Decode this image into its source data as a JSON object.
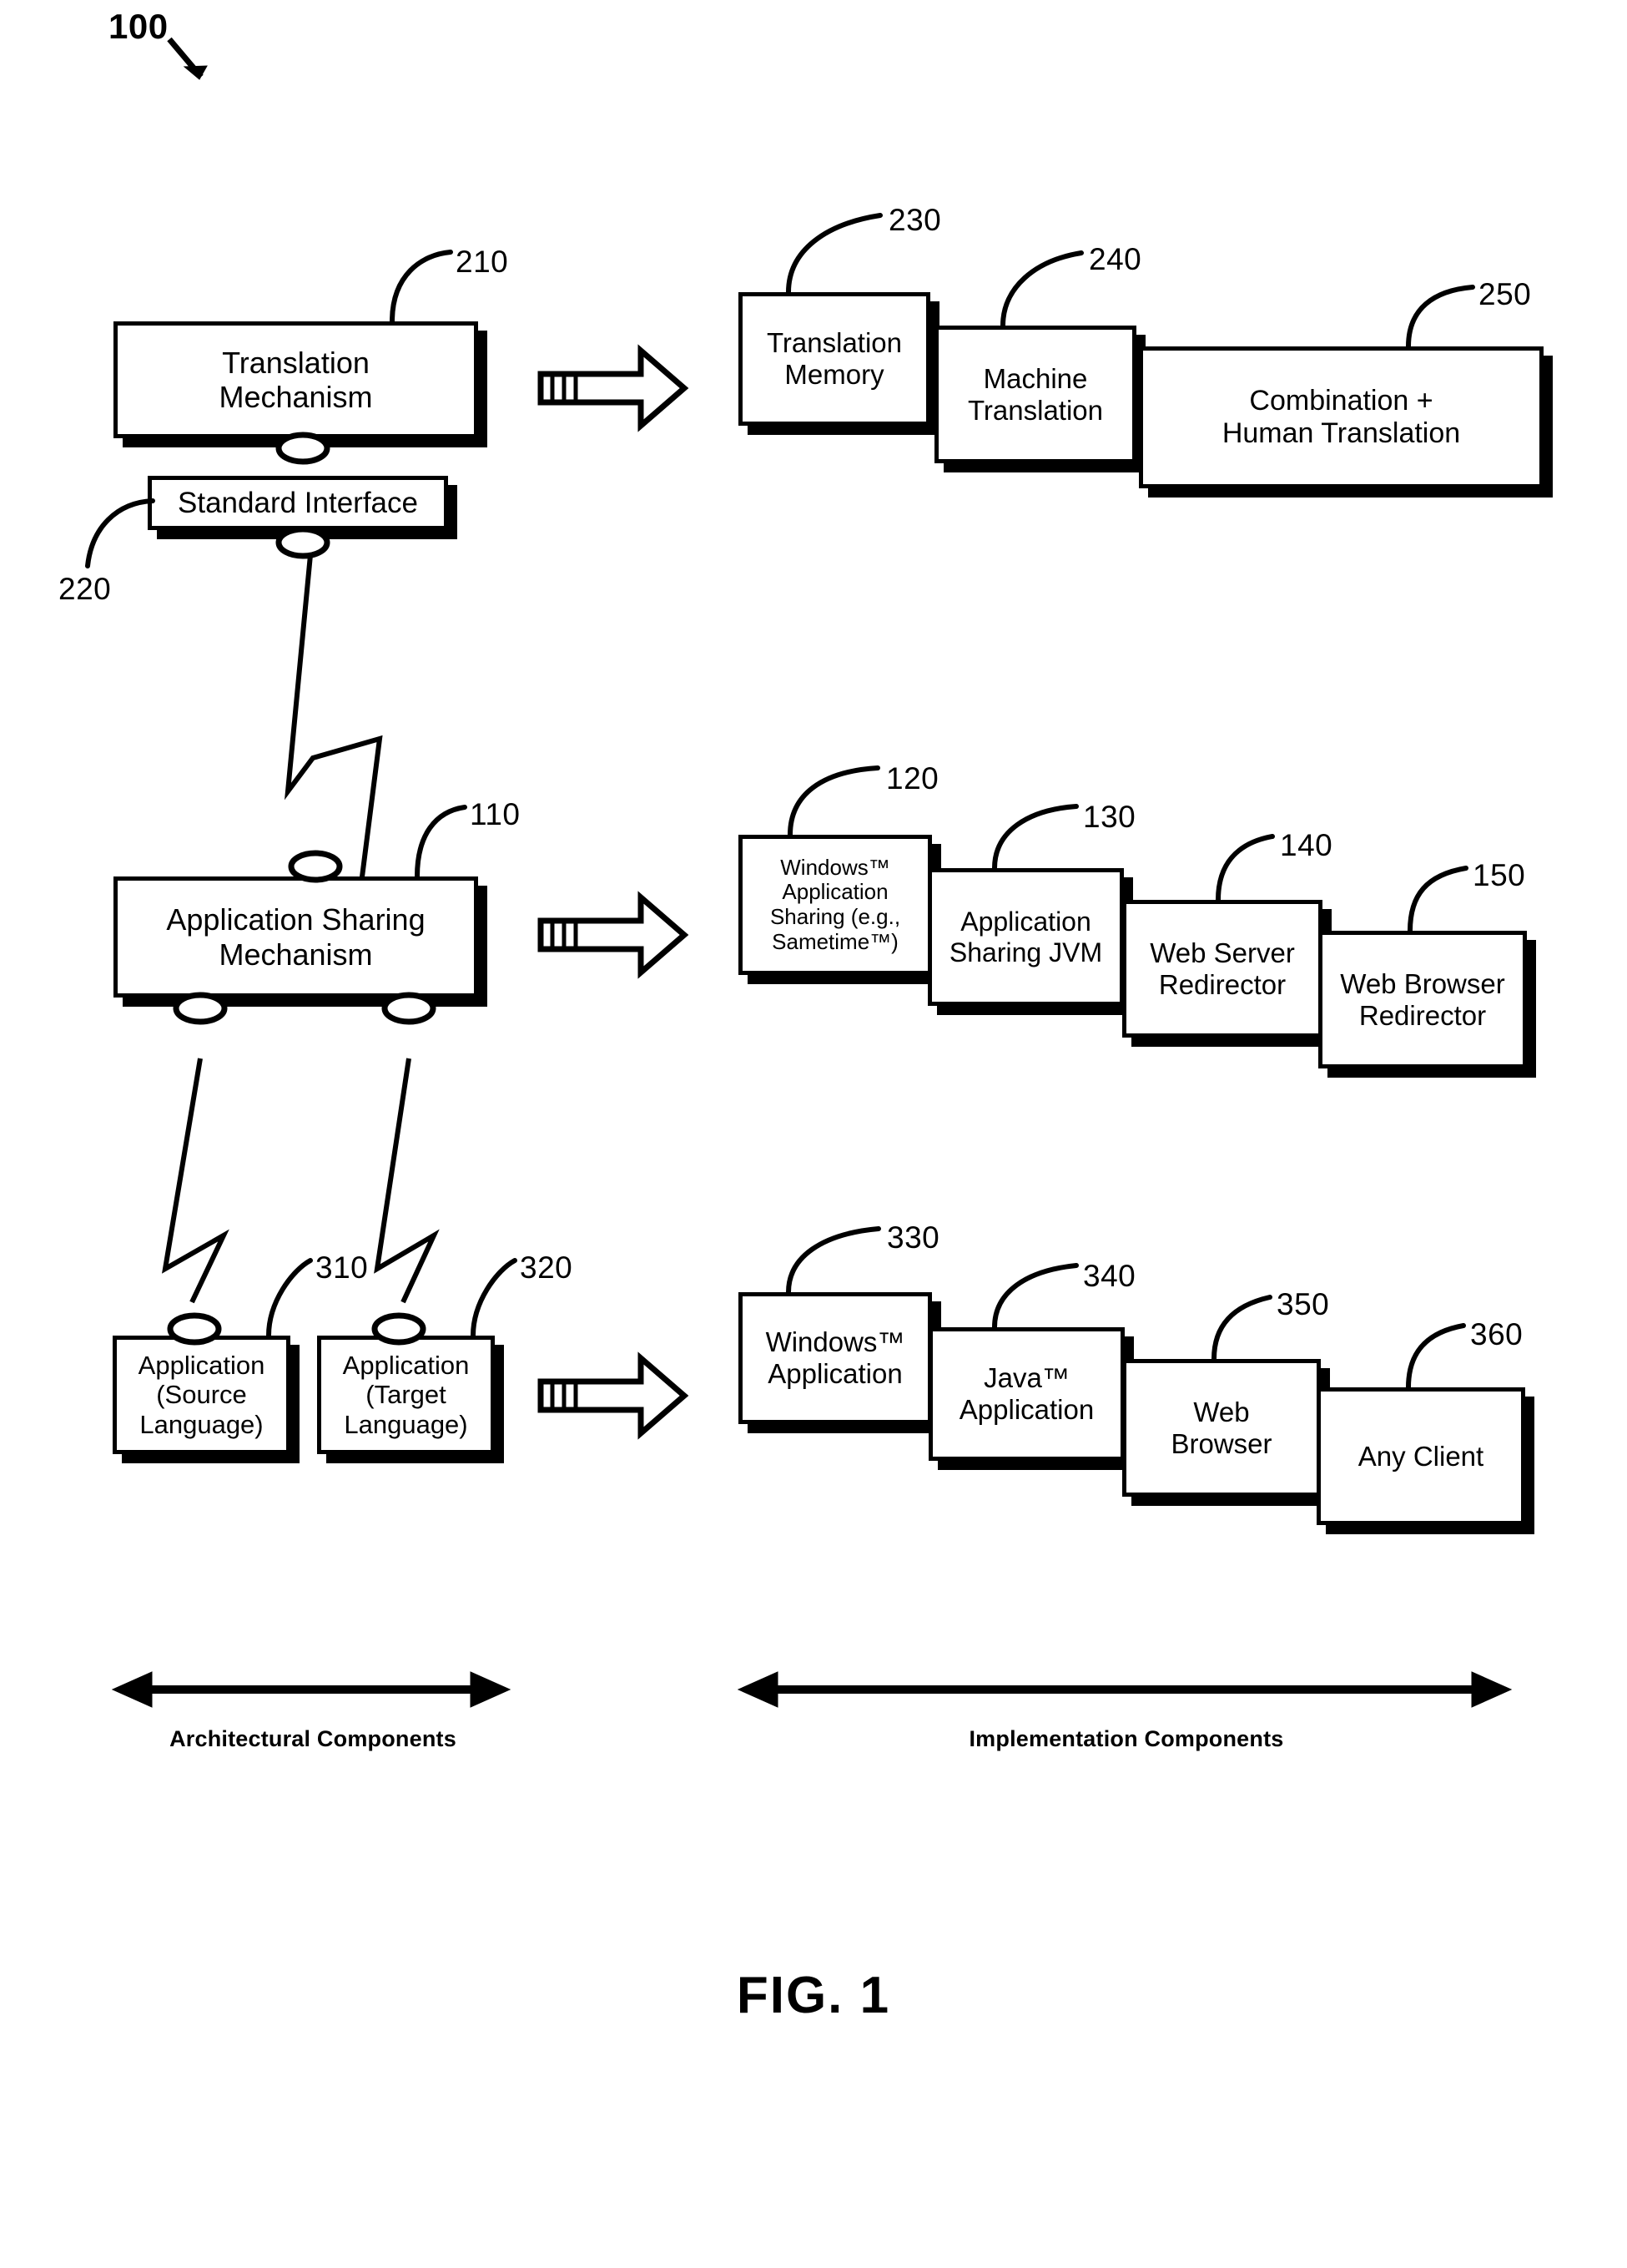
{
  "figure": {
    "title": "FIG. 1",
    "system_ref": "100"
  },
  "captions": {
    "left": "Architectural Components",
    "right": "Implementation Components"
  },
  "architectural_components": [
    {
      "ref": "210",
      "label": "Translation\nMechanism",
      "name": "translation-mechanism"
    },
    {
      "ref": "220",
      "label": "Standard Interface",
      "name": "standard-interface"
    },
    {
      "ref": "110",
      "label": "Application Sharing\nMechanism",
      "name": "application-sharing-mechanism"
    },
    {
      "ref": "310",
      "label": "Application\n(Source\nLanguage)",
      "name": "application-source-language"
    },
    {
      "ref": "320",
      "label": "Application\n(Target\nLanguage)",
      "name": "application-target-language"
    }
  ],
  "implementation_rows": [
    {
      "name": "translation-implementations",
      "items": [
        {
          "ref": "230",
          "label": "Translation\nMemory",
          "name": "translation-memory"
        },
        {
          "ref": "240",
          "label": "Machine\nTranslation",
          "name": "machine-translation"
        },
        {
          "ref": "250",
          "label": "Combination +\nHuman Translation",
          "name": "combination-human-translation"
        }
      ]
    },
    {
      "name": "application-sharing-implementations",
      "items": [
        {
          "ref": "120",
          "label": "Windows™\nApplication\nSharing (e.g.,\nSametime™)",
          "name": "windows-application-sharing"
        },
        {
          "ref": "130",
          "label": "Application\nSharing JVM",
          "name": "application-sharing-jvm"
        },
        {
          "ref": "140",
          "label": "Web Server\nRedirector",
          "name": "web-server-redirector"
        },
        {
          "ref": "150",
          "label": "Web Browser\nRedirector",
          "name": "web-browser-redirector"
        }
      ]
    },
    {
      "name": "application-implementations",
      "items": [
        {
          "ref": "330",
          "label": "Windows™\nApplication",
          "name": "windows-application"
        },
        {
          "ref": "340",
          "label": "Java™\nApplication",
          "name": "java-application"
        },
        {
          "ref": "350",
          "label": "Web\nBrowser",
          "name": "web-browser"
        },
        {
          "ref": "360",
          "label": "Any Client",
          "name": "any-client"
        }
      ]
    }
  ],
  "colors": {
    "stroke": "#000000",
    "fill": "#ffffff"
  }
}
